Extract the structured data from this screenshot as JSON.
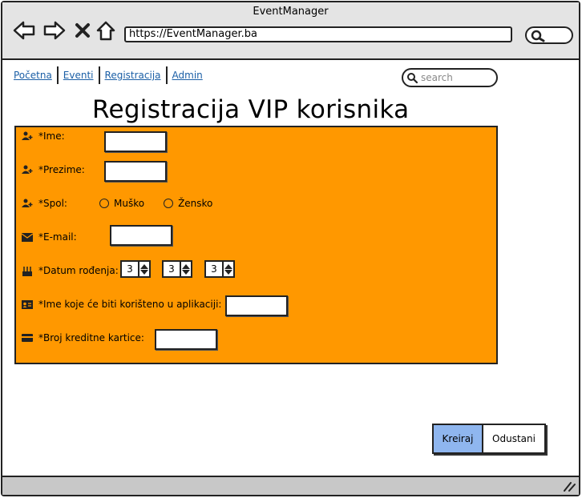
{
  "window": {
    "title": "EventManager"
  },
  "browser": {
    "url": "https://EventManager.ba"
  },
  "nav": {
    "links": [
      "Početna",
      "Eventi",
      "Registracija",
      "Admin"
    ]
  },
  "search": {
    "placeholder": "search"
  },
  "page": {
    "title": "Registracija VIP korisnika"
  },
  "form": {
    "ime": {
      "label": "*Ime:",
      "value": ""
    },
    "prezime": {
      "label": "*Prezime:",
      "value": ""
    },
    "spol": {
      "label": "*Spol:",
      "options": [
        "Muško",
        "Žensko"
      ]
    },
    "email": {
      "label": "*E-mail:",
      "value": ""
    },
    "datum": {
      "label": "*Datum rođenja:",
      "values": [
        "3",
        "3",
        "3"
      ]
    },
    "username": {
      "label": "*Ime koje će biti korišteno u aplikaciji:",
      "value": ""
    },
    "kartica": {
      "label": "*Broj kreditne kartice:",
      "value": ""
    }
  },
  "buttons": {
    "create": "Kreiraj",
    "cancel": "Odustani"
  },
  "colors": {
    "form_bg": "#ff9800",
    "primary_button": "#8fb6ef",
    "link": "#1b5fa6"
  }
}
